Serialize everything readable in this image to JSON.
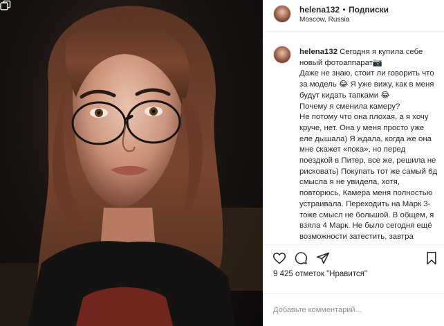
{
  "post": {
    "username": "helena132",
    "separator": "•",
    "follow_label": "Подписки",
    "location": "Moscow, Russia",
    "caption": "Сегодня я купила себе новый фотоаппарат📷\nДаже не знаю, стоит ли говорить что за модель 😂 Я уже вижу, как в меня будут кидать тапками 😂\nПочему я сменила камеру?\nНе потому что она плохая, а я хочу круче, нет. Она у меня просто уже еле дышала) Я ждала, когда же она мне скажет «пока», но перед поездкой в Питер, все же, решила не рисковать) Покупать тот же самый 6д смысла я не увидела, хотя, повторюсь, Камера меня полностью устраивала. Переходить на Марк 3- тоже смысл не большой. В общем, я взяла 4 Марк. Не было сегодня ещё возможности затестить, завтра расскажу свои чувства) я на него ни разу не",
    "likes": "9 425 отметок \"Нравится\"",
    "comment_placeholder": "Добавьте комментарий..."
  },
  "icons": {
    "like": "heart-icon",
    "comment": "comment-icon",
    "share": "paper-plane-icon",
    "save": "bookmark-icon",
    "carousel": "carousel-icon"
  },
  "colors": {
    "text": "#262626",
    "muted": "#8e8e8e",
    "border": "#efefef"
  }
}
